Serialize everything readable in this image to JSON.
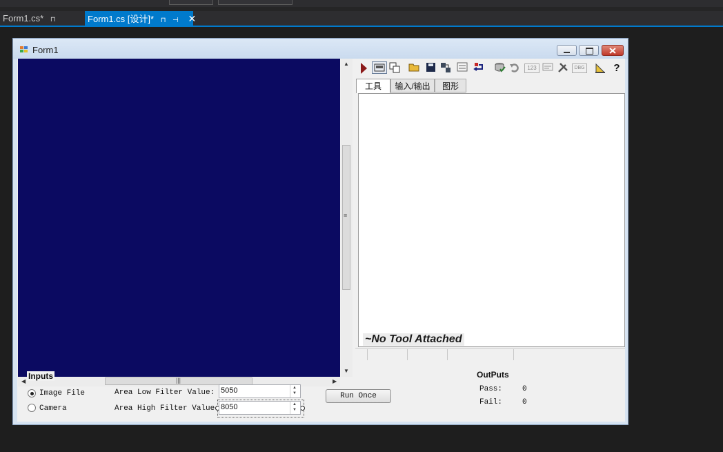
{
  "ide": {
    "tabs": [
      {
        "label": "Form1.cs*",
        "pin": "⊓"
      },
      {
        "label": "Form1.cs [设计]*",
        "pin": "⊓",
        "dock": "⊣",
        "close": "✕"
      }
    ],
    "accent_color": "#007acc"
  },
  "form": {
    "title": "Form1",
    "window_buttons": [
      "minimize-icon",
      "maximize-icon",
      "close-icon"
    ],
    "display_color": "#0b0a61",
    "toolbar": {
      "icons": [
        "run-icon",
        "display-icon",
        "copy-icon",
        "open-folder-icon",
        "save-icon",
        "link-icon",
        "list-icon",
        "import-icon",
        "database-icon",
        "undo-icon",
        "123-icon",
        "text-icon",
        "tools-icon",
        "dbg-icon",
        "ruler-icon",
        "help-icon"
      ],
      "help_label": "?"
    },
    "panel_tabs": [
      "工具",
      "输入/输出",
      "图形"
    ],
    "no_tool_text": "~No Tool Attached",
    "inputs": {
      "group_title": "Inputs",
      "radio_image_file": "Image File",
      "radio_camera": "Camera",
      "selected": "Image File",
      "low_label": "Area Low Filter Value:",
      "low_value": "5050",
      "high_label": "Area High Filter Value:",
      "high_value": "8050"
    },
    "run_once_label": "Run Once",
    "outputs": {
      "title": "OutPuts",
      "pass_label": "Pass:",
      "pass_value": "0",
      "fail_label": "Fail:",
      "fail_value": "0"
    }
  }
}
